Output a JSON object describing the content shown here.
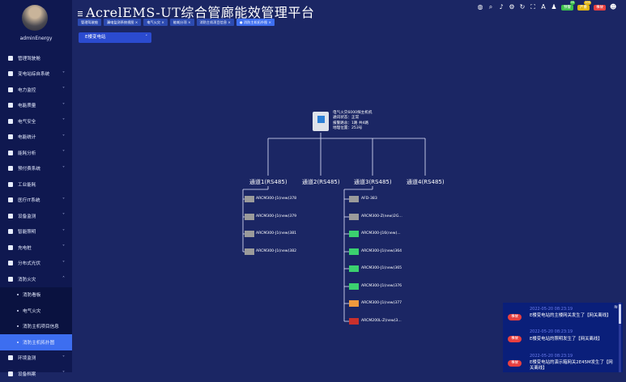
{
  "app": {
    "title": "AcrelEMS-UT综合管廊能效管理平台",
    "user": "adminEnergy"
  },
  "colors": {
    "gray": "#9b9b9b",
    "green": "#3bd16f",
    "orange": "#ef9a3e",
    "red": "#c9302c",
    "badge_green": "#3cc24b",
    "badge_yellow": "#e2b512",
    "badge_red": "#e83f3f"
  },
  "sidebar": {
    "items": [
      {
        "label": "管理驾驶舱",
        "arrow": ""
      },
      {
        "label": "变电站综自系统",
        "arrow": "˅"
      },
      {
        "label": "电力监控",
        "arrow": "˅"
      },
      {
        "label": "电能质量",
        "arrow": "˅"
      },
      {
        "label": "电气安全",
        "arrow": "˅"
      },
      {
        "label": "电能统计",
        "arrow": "˅"
      },
      {
        "label": "能耗分析",
        "arrow": "˅"
      },
      {
        "label": "预付费系统",
        "arrow": "˅"
      },
      {
        "label": "工业能耗",
        "arrow": ""
      },
      {
        "label": "医疗IT系统",
        "arrow": "˅"
      },
      {
        "label": "设备监测",
        "arrow": "˅"
      },
      {
        "label": "智能照明",
        "arrow": "˅"
      },
      {
        "label": "充电桩",
        "arrow": "˅"
      },
      {
        "label": "分布式光伏",
        "arrow": "˅"
      },
      {
        "label": "消防火灾",
        "arrow": "˄"
      }
    ],
    "subitems": [
      {
        "label": "消防看板"
      },
      {
        "label": "电气火灾"
      },
      {
        "label": "消防主机项目信息"
      },
      {
        "label": "消防主机拓扑图"
      }
    ],
    "tail": [
      {
        "label": "环境监测",
        "arrow": "˅"
      },
      {
        "label": "设备档案",
        "arrow": "˅"
      }
    ]
  },
  "header_badges": [
    {
      "label": "预警",
      "count": "99"
    },
    {
      "label": "严重",
      "count": "100"
    },
    {
      "label": "事故",
      "count": ""
    }
  ],
  "tabs": [
    {
      "label": "管理驾驶舱"
    },
    {
      "label": "漏电监测系统视图"
    },
    {
      "label": "电气火灾"
    },
    {
      "label": "能耗分项"
    },
    {
      "label": "消防主机项目信息"
    },
    {
      "label": "● 消防主机拓扑图"
    }
  ],
  "station": {
    "value": "E楼变电站"
  },
  "host": {
    "lines": [
      "电气火灾6000探主机机",
      "通讯状态：正常",
      "报警路总：1路 共4路",
      "地理位置：253号"
    ]
  },
  "channels": [
    "通道1(RS485)",
    "通道2(RS485)",
    "通道3(RS485)",
    "通道4(RS485)"
  ],
  "ch1_devices": [
    {
      "label": "ARCM300-J1(new)378",
      "status": "gray"
    },
    {
      "label": "ARCM300-J1(new)379",
      "status": "gray"
    },
    {
      "label": "ARCM300-J1(new)381",
      "status": "gray"
    },
    {
      "label": "ARCM300-J1(new)382",
      "status": "gray"
    }
  ],
  "ch3_devices": [
    {
      "label": "AFD-383",
      "status": "gray"
    },
    {
      "label": "ARCM300-Z(new)2G...",
      "status": "gray"
    },
    {
      "label": "ARCM300-J16(new)...",
      "status": "green"
    },
    {
      "label": "ARCM300-J1(new)364",
      "status": "green"
    },
    {
      "label": "ARCM300-J1(new)365",
      "status": "green"
    },
    {
      "label": "ARCM300-J1(new)376",
      "status": "green"
    },
    {
      "label": "ARCM300-J1(new)377",
      "status": "orange"
    },
    {
      "label": "ARCM200L-Z(new)3...",
      "status": "red"
    }
  ],
  "notifications": [
    {
      "tag": "事故",
      "time": "2022-05-20 08:23:19",
      "msg": "E楼变电站的主楼网关发生了【网关离线】"
    },
    {
      "tag": "事故",
      "time": "2022-05-20 08:23:19",
      "msg": "E楼变电站的照明发生了【网关离线】"
    },
    {
      "tag": "事故",
      "time": "2022-05-20 08:23:19",
      "msg": "E楼变电站的演示箱网关2E45M发生了【网关离线】"
    }
  ]
}
